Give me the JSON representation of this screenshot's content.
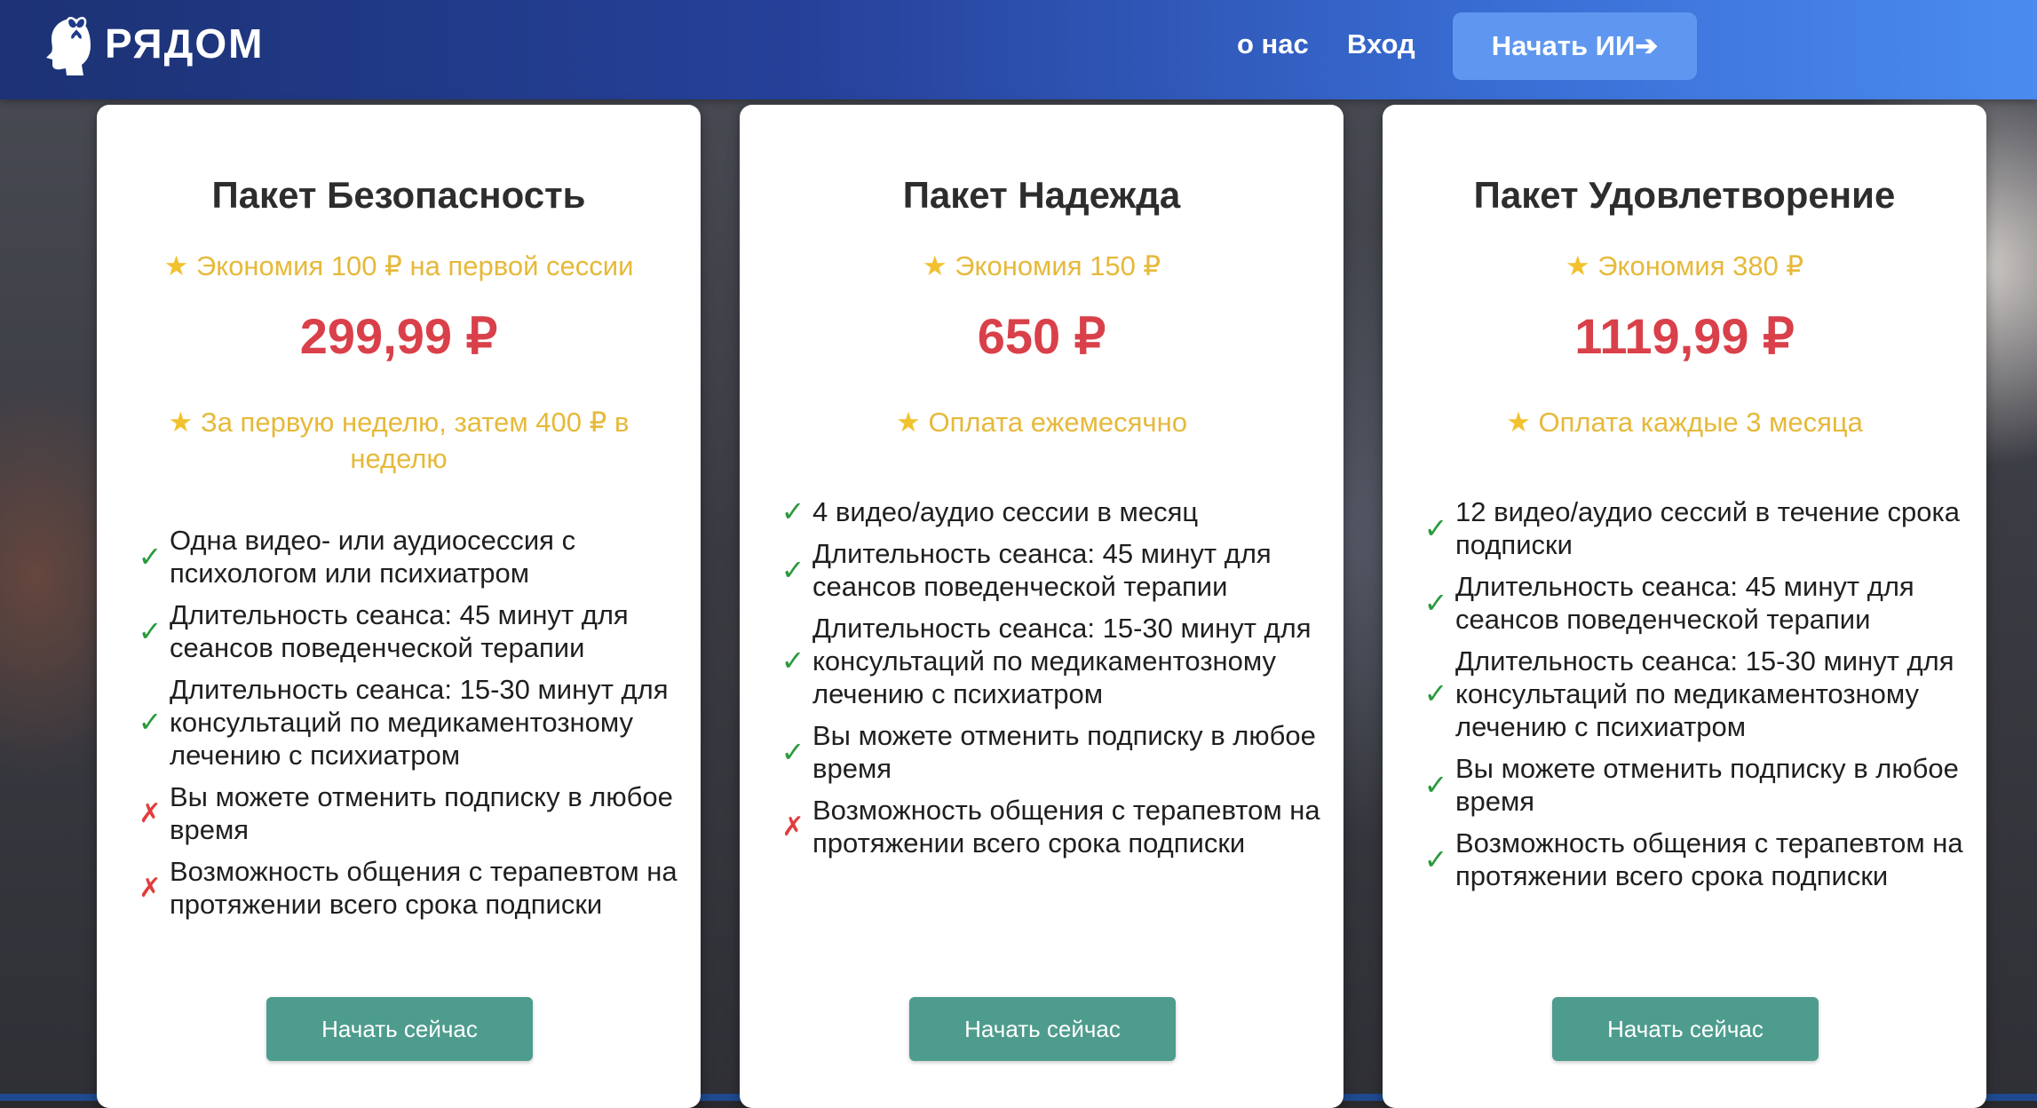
{
  "header": {
    "logo_text": "РЯДОМ",
    "nav_about": "о нас",
    "nav_login": "Вход",
    "cta_label": "Начать ИИ➔"
  },
  "colors": {
    "header_start": "#1c3274",
    "header_end": "#4b8bf0",
    "cta_bg": "#5f97f0",
    "price": "#d9404a",
    "saving": "#e6b93a",
    "check": "#2a9a3c",
    "cross": "#e23c3c",
    "button": "#4e9c8d"
  },
  "star_glyph": "★",
  "cards": [
    {
      "title": "Пакет Безопасность",
      "saving": "Экономия 100 ₽ на первой сессии",
      "price": "299,99 ₽",
      "note": "За первую неделю, затем 400 ₽ в неделю",
      "features": [
        {
          "text": "Одна видео- или аудиосессия с психологом или психиатром",
          "included": true,
          "mark": "✓"
        },
        {
          "text": "Длительность сеанса: 45 минут для сеансов поведенческой терапии",
          "included": true,
          "mark": "✓"
        },
        {
          "text": "Длительность сеанса: 15-30 минут для консультаций по медикаментозному лечению с психиатром",
          "included": true,
          "mark": "✓"
        },
        {
          "text": "Вы можете отменить подписку в любое время",
          "included": false,
          "mark": "✗"
        },
        {
          "text": "Возможность общения с терапевтом на протяжении всего срока подписки",
          "included": false,
          "mark": "✗"
        }
      ],
      "button": "Начать сейчас"
    },
    {
      "title": "Пакет Надежда",
      "saving": "Экономия 150 ₽",
      "price": "650 ₽",
      "note": "Оплата ежемесячно",
      "features": [
        {
          "text": "4 видео/аудио сессии в месяц",
          "included": true,
          "mark": "✓"
        },
        {
          "text": "Длительность сеанса: 45 минут для сеансов поведенческой терапии",
          "included": true,
          "mark": "✓"
        },
        {
          "text": "Длительность сеанса: 15-30 минут для консультаций по медикаментозному лечению с психиатром",
          "included": true,
          "mark": "✓"
        },
        {
          "text": "Вы можете отменить подписку в любое время",
          "included": true,
          "mark": "✓"
        },
        {
          "text": "Возможность общения с терапевтом на протяжении всего срока подписки",
          "included": false,
          "mark": "✗"
        }
      ],
      "button": "Начать сейчас"
    },
    {
      "title": "Пакет Удовлетворение",
      "saving": "Экономия 380 ₽",
      "price": "1119,99 ₽",
      "note": "Оплата каждые 3 месяца",
      "features": [
        {
          "text": "12 видео/аудио сессий в течение срока подписки",
          "included": true,
          "mark": "✓"
        },
        {
          "text": "Длительность сеанса: 45 минут для сеансов поведенческой терапии",
          "included": true,
          "mark": "✓"
        },
        {
          "text": "Длительность сеанса: 15-30 минут для консультаций по медикаментозному лечению с психиатром",
          "included": true,
          "mark": "✓"
        },
        {
          "text": "Вы можете отменить подписку в любое время",
          "included": true,
          "mark": "✓"
        },
        {
          "text": "Возможность общения с терапевтом на протяжении всего срока подписки",
          "included": true,
          "mark": "✓"
        }
      ],
      "button": "Начать сейчас"
    }
  ]
}
